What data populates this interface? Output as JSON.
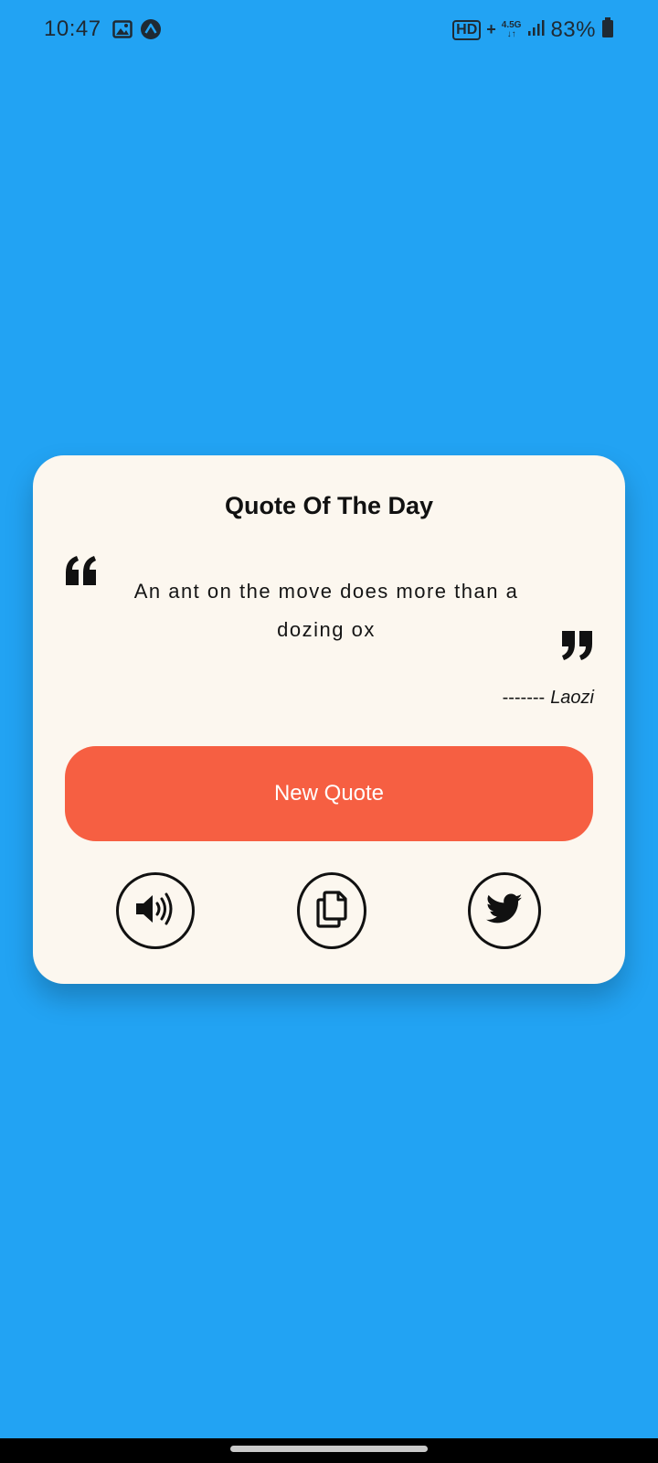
{
  "status_bar": {
    "time": "10:47",
    "hd_label": "HD",
    "plus_label": "+",
    "net_top": "4.5G",
    "net_bottom": "↓↑",
    "battery_text": "83%",
    "icons": [
      "image-icon",
      "app-notification-icon",
      "signal-icon",
      "battery-icon"
    ]
  },
  "card": {
    "title": "Quote Of The Day",
    "quote": "An ant on the move does more than a dozing ox",
    "author_prefix": "-------",
    "author": "Laozi",
    "new_quote_label": "New Quote",
    "actions": [
      "speaker-icon",
      "copy-icon",
      "twitter-icon"
    ]
  },
  "colors": {
    "background": "#22a3f3",
    "card": "#fcf7ef",
    "button": "#f65f42",
    "text": "#111111"
  }
}
